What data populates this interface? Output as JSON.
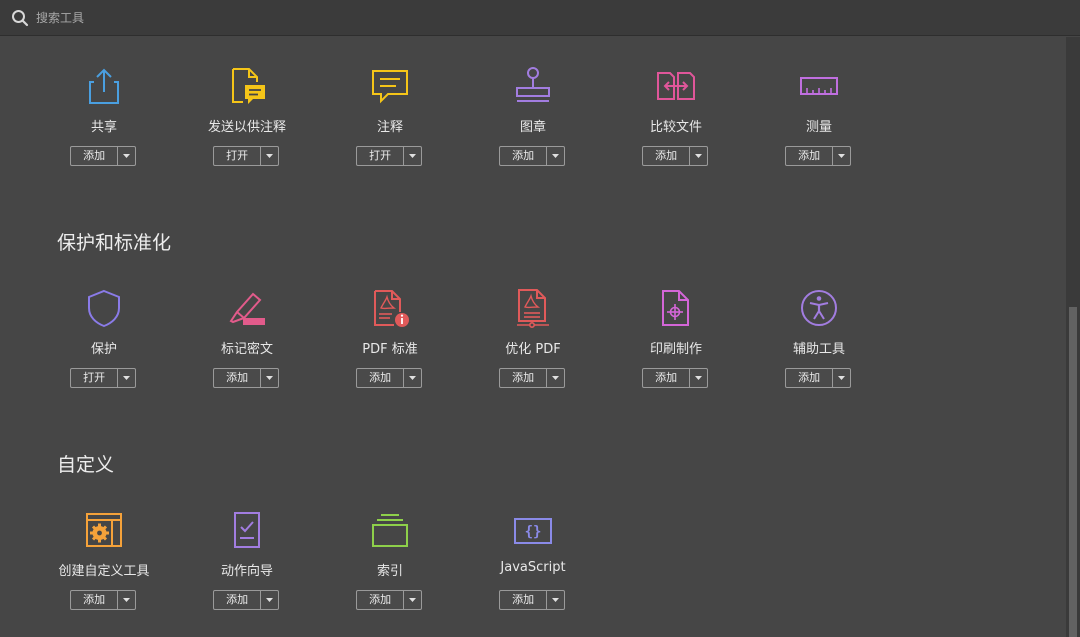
{
  "search": {
    "placeholder": "搜索工具"
  },
  "sections": [
    {
      "title": "",
      "tools": [
        {
          "label": "共享",
          "button": "添加",
          "icon": "share-icon",
          "color": "#4a9fe0"
        },
        {
          "label": "发送以供注释",
          "button": "打开",
          "icon": "send-for-comments-icon",
          "color": "#f5c518"
        },
        {
          "label": "注释",
          "button": "打开",
          "icon": "comment-icon",
          "color": "#f5c518"
        },
        {
          "label": "图章",
          "button": "添加",
          "icon": "stamp-icon",
          "color": "#a27de0"
        },
        {
          "label": "比较文件",
          "button": "添加",
          "icon": "compare-files-icon",
          "color": "#e0569a"
        },
        {
          "label": "测量",
          "button": "添加",
          "icon": "measure-icon",
          "color": "#c06fe0"
        }
      ]
    },
    {
      "title": "保护和标准化",
      "tools": [
        {
          "label": "保护",
          "button": "打开",
          "icon": "protect-shield-icon",
          "color": "#8a7be8"
        },
        {
          "label": "标记密文",
          "button": "添加",
          "icon": "redact-icon",
          "color": "#e25b8b"
        },
        {
          "label": "PDF 标准",
          "button": "添加",
          "icon": "pdf-standards-icon",
          "color": "#e05a5a"
        },
        {
          "label": "优化 PDF",
          "button": "添加",
          "icon": "optimize-pdf-icon",
          "color": "#e05a5a"
        },
        {
          "label": "印刷制作",
          "button": "添加",
          "icon": "print-production-icon",
          "color": "#d466d8"
        },
        {
          "label": "辅助工具",
          "button": "添加",
          "icon": "accessibility-icon",
          "color": "#a27de0"
        }
      ]
    },
    {
      "title": "自定义",
      "tools": [
        {
          "label": "创建自定义工具",
          "button": "添加",
          "icon": "create-custom-tool-icon",
          "color": "#f5a23a"
        },
        {
          "label": "动作向导",
          "button": "添加",
          "icon": "action-wizard-icon",
          "color": "#a27de0"
        },
        {
          "label": "索引",
          "button": "添加",
          "icon": "index-icon",
          "color": "#8ed04a"
        },
        {
          "label": "JavaScript",
          "button": "添加",
          "icon": "javascript-icon",
          "color": "#8a8ae8"
        }
      ]
    }
  ]
}
